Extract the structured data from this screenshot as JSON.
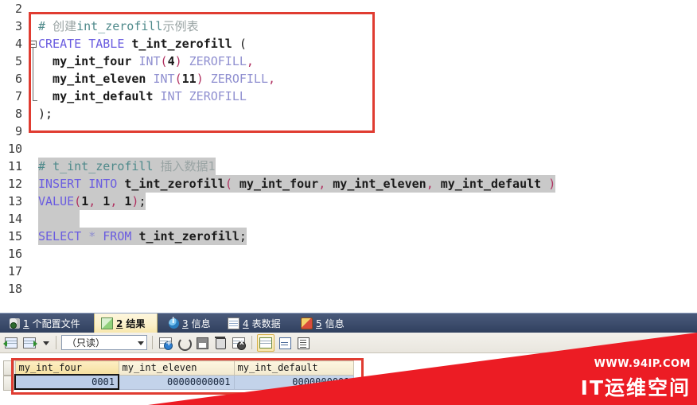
{
  "editor": {
    "gutter_lines": [
      "2",
      "3",
      "4",
      "5",
      "6",
      "7",
      "8",
      "9",
      "10",
      "11",
      "12",
      "13",
      "14",
      "15",
      "16",
      "17",
      "18"
    ],
    "lines": [
      {
        "num": "2",
        "segments": []
      },
      {
        "num": "3",
        "segments": [
          {
            "t": "# ",
            "c": "comment"
          },
          {
            "t": "创建",
            "c": "cn"
          },
          {
            "t": "int_zerofill",
            "c": "comment"
          },
          {
            "t": "示例表",
            "c": "cn"
          }
        ]
      },
      {
        "num": "4",
        "segments": [
          {
            "t": "CREATE TABLE ",
            "c": "kw"
          },
          {
            "t": "t_int_zerofill ",
            "c": "id"
          },
          {
            "t": "(",
            "c": "plain"
          }
        ]
      },
      {
        "num": "5",
        "segments": [
          {
            "t": "  my_int_four ",
            "c": "id"
          },
          {
            "t": "INT",
            "c": "type"
          },
          {
            "t": "(",
            "c": "punc"
          },
          {
            "t": "4",
            "c": "num"
          },
          {
            "t": ")",
            "c": "punc"
          },
          {
            "t": " ZEROFILL",
            "c": "type"
          },
          {
            "t": ",",
            "c": "punc"
          }
        ]
      },
      {
        "num": "6",
        "segments": [
          {
            "t": "  my_int_eleven ",
            "c": "id"
          },
          {
            "t": "INT",
            "c": "type"
          },
          {
            "t": "(",
            "c": "punc"
          },
          {
            "t": "11",
            "c": "num"
          },
          {
            "t": ")",
            "c": "punc"
          },
          {
            "t": " ZEROFILL",
            "c": "type"
          },
          {
            "t": ",",
            "c": "punc"
          }
        ]
      },
      {
        "num": "7",
        "segments": [
          {
            "t": "  my_int_default ",
            "c": "id"
          },
          {
            "t": "INT ZEROFILL",
            "c": "type"
          }
        ]
      },
      {
        "num": "8",
        "segments": [
          {
            "t": ");",
            "c": "plain"
          }
        ]
      },
      {
        "num": "9",
        "segments": []
      },
      {
        "num": "10",
        "segments": []
      },
      {
        "num": "11",
        "segments": [
          {
            "t": "# ",
            "c": "comment"
          },
          {
            "t": "t_int_zerofill",
            "c": "comment"
          },
          {
            "t": " 插入数据1",
            "c": "cn"
          }
        ],
        "selected": true
      },
      {
        "num": "12",
        "segments": [
          {
            "t": "INSERT INTO ",
            "c": "kw"
          },
          {
            "t": "t_int_zerofill",
            "c": "id"
          },
          {
            "t": "(",
            "c": "punc"
          },
          {
            "t": " my_int_four",
            "c": "id"
          },
          {
            "t": ",",
            "c": "punc"
          },
          {
            "t": " my_int_eleven",
            "c": "id"
          },
          {
            "t": ",",
            "c": "punc"
          },
          {
            "t": " my_int_default ",
            "c": "id"
          },
          {
            "t": ")",
            "c": "punc"
          }
        ],
        "selected": true
      },
      {
        "num": "13",
        "segments": [
          {
            "t": "VALUE",
            "c": "kw"
          },
          {
            "t": "(",
            "c": "punc"
          },
          {
            "t": "1",
            "c": "num"
          },
          {
            "t": ", ",
            "c": "punc"
          },
          {
            "t": "1",
            "c": "num"
          },
          {
            "t": ", ",
            "c": "punc"
          },
          {
            "t": "1",
            "c": "num"
          },
          {
            "t": ")",
            "c": "punc"
          },
          {
            "t": ";",
            "c": "plain"
          }
        ],
        "selected": true
      },
      {
        "num": "14",
        "segments": [],
        "selected": true
      },
      {
        "num": "15",
        "segments": [
          {
            "t": "SELECT ",
            "c": "kw"
          },
          {
            "t": "*",
            "c": "star"
          },
          {
            "t": " FROM ",
            "c": "kw"
          },
          {
            "t": "t_int_zerofill",
            "c": "id"
          },
          {
            "t": ";",
            "c": "plain"
          }
        ],
        "selected": true
      },
      {
        "num": "16",
        "segments": []
      },
      {
        "num": "17",
        "segments": []
      },
      {
        "num": "18",
        "segments": []
      }
    ]
  },
  "tabs": [
    {
      "num": "1",
      "label": "个配置文件",
      "icon": "profile-icon",
      "active": false
    },
    {
      "num": "2",
      "label": "结果",
      "icon": "result-icon",
      "active": true
    },
    {
      "num": "3",
      "label": "信息",
      "icon": "info-icon",
      "active": false
    },
    {
      "num": "4",
      "label": "表数据",
      "icon": "table-icon",
      "active": false
    },
    {
      "num": "5",
      "label": "信息",
      "icon": "info-alt-icon",
      "active": false
    }
  ],
  "toolbar": {
    "mode_value": "（只读）",
    "buttons": [
      {
        "name": "import-grid-button",
        "title": "导入"
      },
      {
        "name": "export-grid-button",
        "title": "导出"
      },
      {
        "name": "export-dropdown",
        "title": "更多"
      },
      {
        "name": "add-record-button",
        "title": "添加记录"
      },
      {
        "name": "refresh-button",
        "title": "刷新"
      },
      {
        "name": "apply-changes-button",
        "title": "应用改变"
      },
      {
        "name": "delete-record-button",
        "title": "删除记录"
      },
      {
        "name": "cancel-changes-button",
        "title": "取消改变"
      },
      {
        "name": "grid-view-button",
        "title": "网格视图"
      },
      {
        "name": "form-view-button",
        "title": "表单视图"
      },
      {
        "name": "text-view-button",
        "title": "文本视图"
      }
    ]
  },
  "result_grid": {
    "columns": [
      "my_int_four",
      "my_int_eleven",
      "my_int_default"
    ],
    "rows": [
      [
        "0001",
        "00000000001",
        "0000000001"
      ]
    ]
  },
  "watermark": {
    "url": "WWW.94IP.COM",
    "name": "IT运维空间",
    "color": "#ec1c24"
  },
  "annotation": {
    "color": "#e03c31"
  }
}
